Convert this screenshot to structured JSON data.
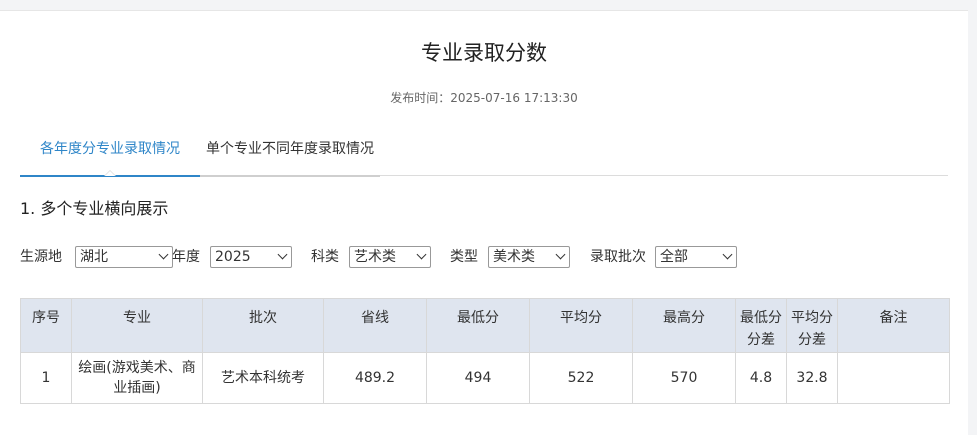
{
  "page": {
    "title": "专业录取分数",
    "publish_time": "发布时间：2025-07-16 17:13:30"
  },
  "tabs": [
    {
      "label": "各年度分专业录取情况",
      "active": true
    },
    {
      "label": "单个专业不同年度录取情况",
      "active": false
    }
  ],
  "section_title": "1. 多个专业横向展示",
  "filters": [
    {
      "label": "生源地",
      "value": "湖北"
    },
    {
      "label": "年度",
      "value": "2025"
    },
    {
      "label": "科类",
      "value": "艺术类"
    },
    {
      "label": "类型",
      "value": "美术类"
    },
    {
      "label": "录取批次",
      "value": "全部"
    }
  ],
  "table": {
    "headers": [
      "序号",
      "专业",
      "批次",
      "省线",
      "最低分",
      "平均分",
      "最高分",
      "最低分分差",
      "平均分分差",
      "备注"
    ],
    "rows": [
      [
        "1",
        "绘画(游戏美术、商业插画)",
        "艺术本科统考",
        "489.2",
        "494",
        "522",
        "570",
        "4.8",
        "32.8",
        ""
      ]
    ]
  },
  "colors": {
    "accent": "#2f86c8",
    "header_bg": "#dfe5ef"
  }
}
